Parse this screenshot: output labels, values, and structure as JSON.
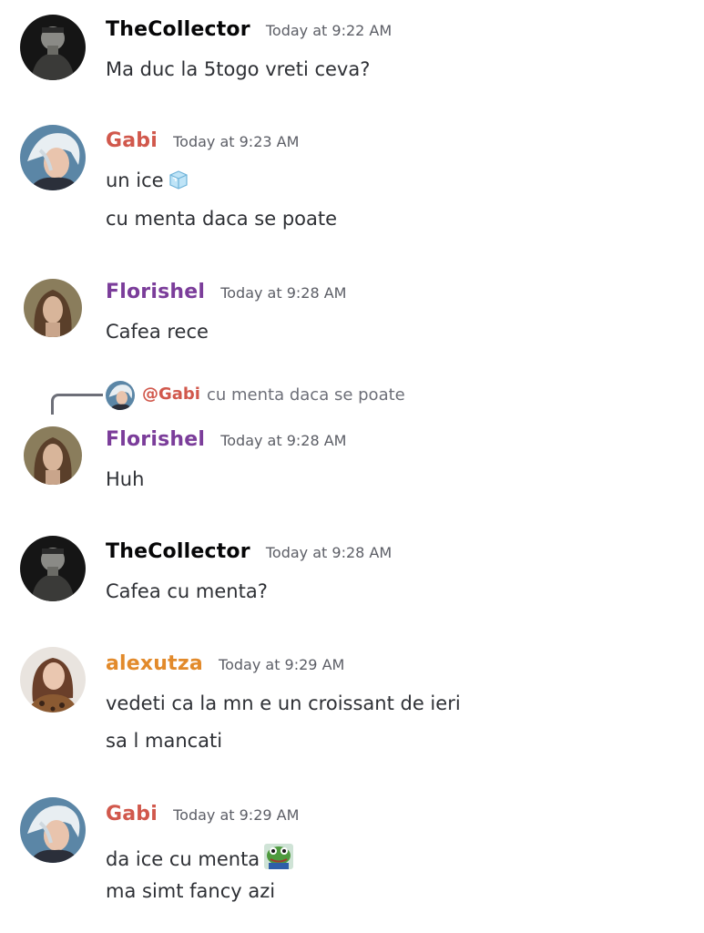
{
  "colors": {
    "collector": "#060607",
    "gabi": "#d1584c",
    "florishel": "#7b3d9a",
    "alexutza": "#e28a2b",
    "text": "#2e3035",
    "timestamp": "#5c5e66",
    "reply_muted": "#6d6f78"
  },
  "messages": [
    {
      "author": "TheCollector",
      "time": "Today at 9:22 AM",
      "avatar": "collector-avatar",
      "lines": [
        "Ma duc la 5togo vreti ceva?"
      ]
    },
    {
      "author": "Gabi",
      "time": "Today at 9:23 AM",
      "avatar": "gabi-avatar",
      "lines": [
        "un ice",
        "cu menta daca se poate"
      ],
      "emoji": "ice-cube-emoji"
    },
    {
      "author": "Florishel",
      "time": "Today at 9:28 AM",
      "avatar": "florishel-avatar",
      "lines": [
        "Cafea rece"
      ]
    },
    {
      "author": "Florishel",
      "time": "Today at 9:28 AM",
      "avatar": "florishel-avatar",
      "lines": [
        "Huh"
      ],
      "reply": {
        "author": "@Gabi",
        "text": "cu menta daca se poate"
      }
    },
    {
      "author": "TheCollector",
      "time": "Today at 9:28 AM",
      "avatar": "collector-avatar",
      "lines": [
        "Cafea cu menta?"
      ]
    },
    {
      "author": "alexutza",
      "time": "Today at 9:29 AM",
      "avatar": "alexutza-avatar",
      "lines": [
        "vedeti ca la mn e un croissant de ieri",
        "sa l mancati"
      ]
    },
    {
      "author": "Gabi",
      "time": "Today at 9:29 AM",
      "avatar": "gabi-avatar",
      "lines": [
        "da ice cu menta",
        "ma simt fancy azi"
      ],
      "emoji": "frog-emoji"
    }
  ]
}
